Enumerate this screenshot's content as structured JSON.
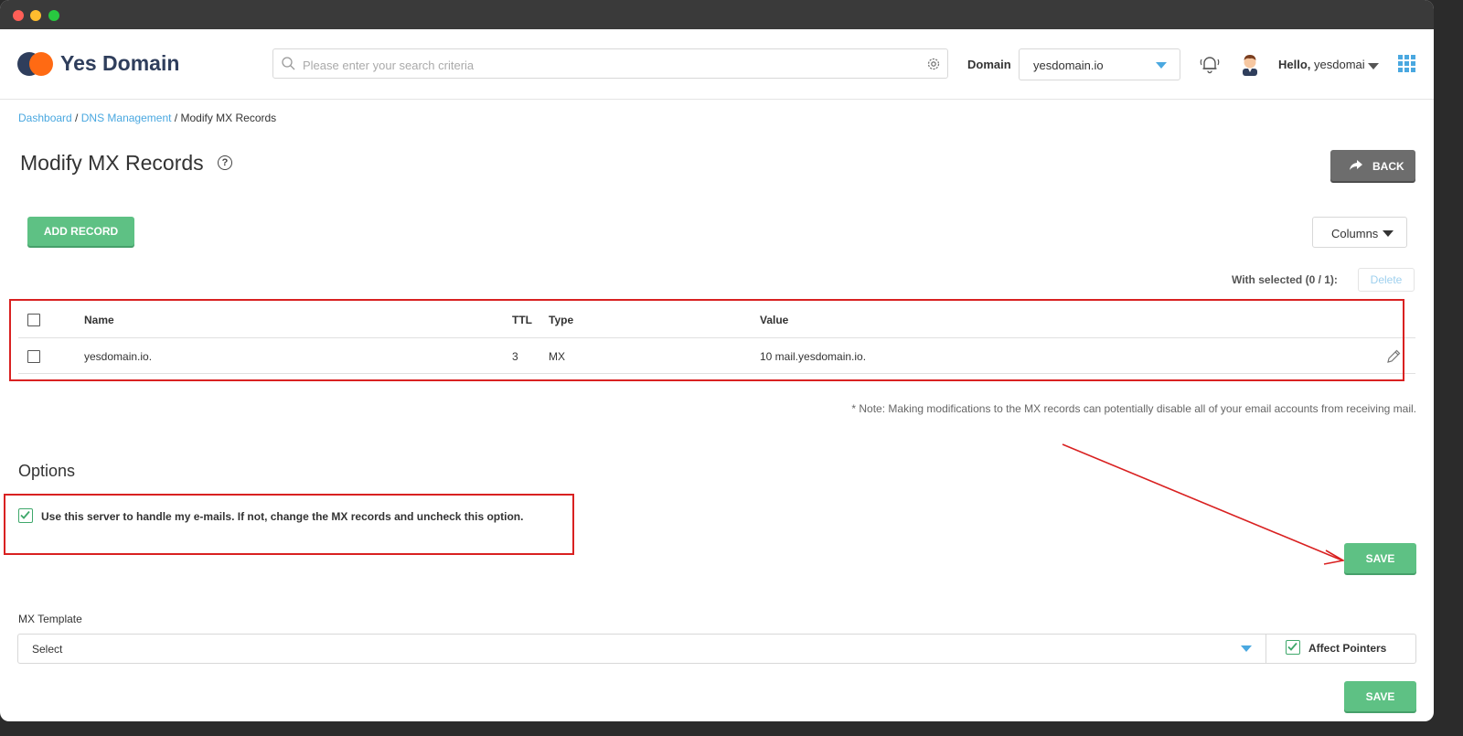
{
  "brand": {
    "name": "Yes Domain",
    "accent": "#ff6a13",
    "primary": "#2f3e5c"
  },
  "search": {
    "placeholder": "Please enter your search criteria"
  },
  "domain": {
    "label": "Domain",
    "selected": "yesdomain.io"
  },
  "user": {
    "hello": "Hello,",
    "name": "yesdomai"
  },
  "breadcrumb": {
    "dashboard": "Dashboard",
    "sep": " / ",
    "dns": "DNS Management",
    "current": "Modify MX Records"
  },
  "page": {
    "title": "Modify MX Records",
    "help": "?",
    "back_label": "BACK"
  },
  "toolbar": {
    "add_record": "ADD RECORD",
    "columns": "Columns",
    "with_selected": "With selected (0 / 1):",
    "delete": "Delete"
  },
  "table": {
    "headers": {
      "name": "Name",
      "ttl": "TTL",
      "type": "Type",
      "value": "Value"
    },
    "rows": [
      {
        "name": "yesdomain.io.",
        "ttl": "3",
        "type": "MX",
        "value": "10 mail.yesdomain.io."
      }
    ]
  },
  "note": "* Note: Making modifications to the MX records can potentially disable all of your email accounts from receiving mail.",
  "options": {
    "title": "Options",
    "use_server_label": "Use this server to handle my e-mails. If not, change the MX records and uncheck this option.",
    "use_server_checked": true,
    "save_label": "SAVE"
  },
  "mx_template": {
    "label": "MX Template",
    "selected": "Select",
    "affect_pointers_label": "Affect Pointers",
    "affect_pointers_checked": true,
    "save_label": "SAVE"
  },
  "colors": {
    "green": "#5ec184",
    "link": "#4aa8e0",
    "annotation_red": "#d92121",
    "back_gray": "#6d6d6d"
  }
}
